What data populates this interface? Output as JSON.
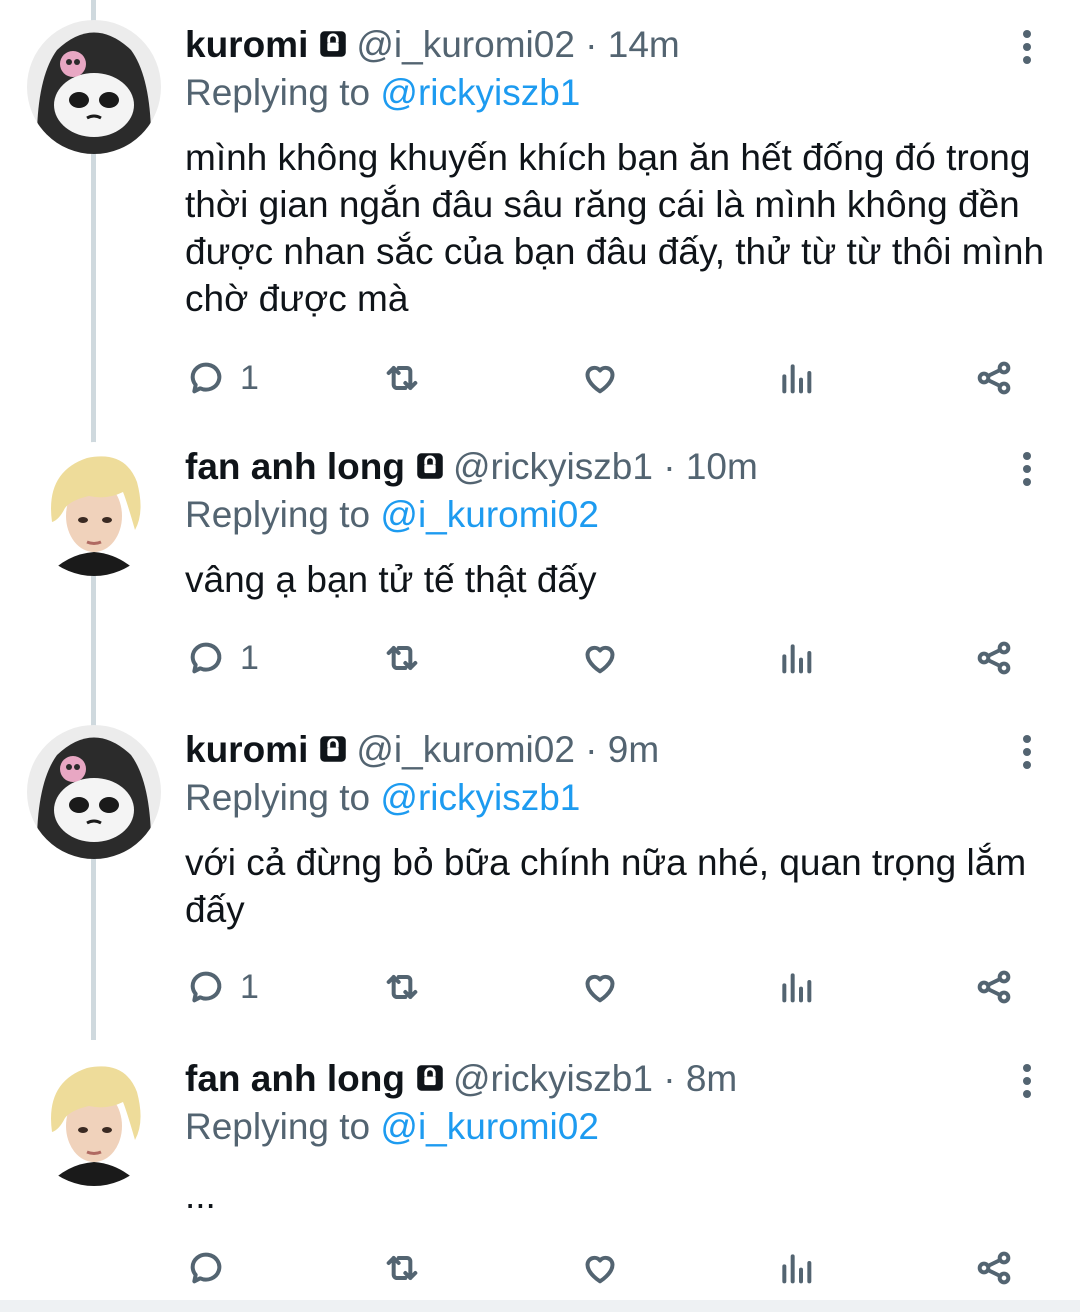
{
  "tweets": [
    {
      "name": "kuromi",
      "handle": "@i_kuromi02",
      "dot": "·",
      "time": "14m",
      "replying_prefix": "Replying to",
      "replying_to": "@rickyiszb1",
      "text": "mình không khuyến khích bạn ăn hết đống đó trong thời gian ngắn đâu sâu răng cái là mình không đền được nhan sắc của bạn đâu đấy, thử từ từ thôi mình chờ được mà",
      "reply_count": "1",
      "avatar": "kuromi-avatar"
    },
    {
      "name": "fan anh long",
      "handle": "@rickyiszb1",
      "dot": "·",
      "time": "10m",
      "replying_prefix": "Replying to",
      "replying_to": "@i_kuromi02",
      "text": "vâng ạ bạn tử tế thật đấy",
      "reply_count": "1",
      "avatar": "blonde-avatar"
    },
    {
      "name": "kuromi",
      "handle": "@i_kuromi02",
      "dot": "·",
      "time": "9m",
      "replying_prefix": "Replying to",
      "replying_to": "@rickyiszb1",
      "text": "với cả đừng bỏ bữa chính nữa nhé, quan trọng lắm đấy",
      "reply_count": "1",
      "avatar": "kuromi-avatar"
    },
    {
      "name": "fan anh long",
      "handle": "@rickyiszb1",
      "dot": "·",
      "time": "8m",
      "replying_prefix": "Replying to",
      "replying_to": "@i_kuromi02",
      "text": "...",
      "reply_count": "",
      "avatar": "blonde-avatar"
    }
  ],
  "icons": {
    "reply": "reply-icon",
    "retweet": "retweet-icon",
    "like": "heart-icon",
    "views": "analytics-icon",
    "share": "share-icon",
    "more": "more-icon",
    "lock": "lock-icon"
  },
  "colors": {
    "link": "#1d9bf0",
    "secondary": "#536471",
    "primary": "#0f1419",
    "thread_line": "#cfd9de"
  }
}
